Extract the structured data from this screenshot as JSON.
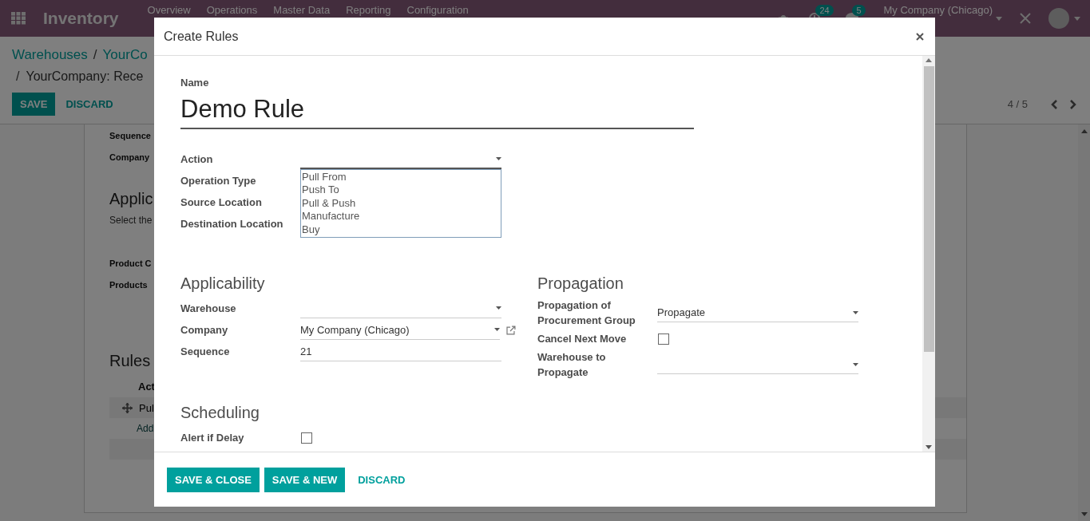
{
  "navbar": {
    "app_title": "Inventory",
    "menu": [
      "Overview",
      "Operations",
      "Master Data",
      "Reporting",
      "Configuration"
    ],
    "notifications": [
      {
        "kind": "activity",
        "count": "24"
      },
      {
        "kind": "chat",
        "count": "5"
      }
    ],
    "company": "My Company (Chicago)"
  },
  "control_panel": {
    "breadcrumbs": [
      {
        "text": "Warehouses"
      },
      {
        "separator": "/",
        "text": "YourCo"
      },
      {
        "separator": "/",
        "text": "YourCompany: Rece"
      }
    ],
    "buttons": [
      {
        "label": "SAVE",
        "kind": "primary"
      },
      {
        "label": "DISCARD",
        "kind": "link"
      }
    ],
    "pager": "4 / 5"
  },
  "sheet": {
    "fields": [
      "Sequence",
      "Company"
    ],
    "section_title": "Applic",
    "hint": "Select the",
    "product_fields": [
      "Product C",
      "Products"
    ],
    "rules_title": "Rules",
    "rules_column": "Act",
    "rule_row": "Pul",
    "add_link": "Add"
  },
  "dialog": {
    "title": "Create Rules",
    "name_label": "Name",
    "name_value": "Demo Rule",
    "action": {
      "label": "Action",
      "expanded": true,
      "options": [
        "Pull From",
        "Push To",
        "Pull & Push",
        "Manufacture",
        "Buy"
      ]
    },
    "hidden_fields": [
      "Operation Type",
      "Source Location",
      "Destination Location"
    ],
    "sections": [
      {
        "title": "Applicability",
        "fields": [
          {
            "label": "Warehouse",
            "kind": "select"
          },
          {
            "label": "Company",
            "kind": "select",
            "value": "My Company (Chicago)",
            "external_link": true
          },
          {
            "label": "Sequence",
            "kind": "text",
            "value": "21"
          }
        ]
      },
      {
        "title": "Propagation",
        "fields": [
          {
            "label": "Propagation of Procurement Group",
            "kind": "select",
            "value": "Propagate"
          },
          {
            "label": "Cancel Next Move",
            "kind": "checkbox",
            "checked": false
          },
          {
            "label": "Warehouse to Propagate",
            "kind": "select"
          }
        ]
      },
      {
        "title": "Scheduling",
        "fields": [
          {
            "label": "Alert if Delay",
            "kind": "checkbox",
            "checked": false
          }
        ]
      }
    ],
    "buttons": [
      {
        "label": "SAVE & CLOSE",
        "kind": "primary"
      },
      {
        "label": "SAVE & NEW",
        "kind": "primary"
      },
      {
        "label": "DISCARD",
        "kind": "link"
      }
    ]
  }
}
